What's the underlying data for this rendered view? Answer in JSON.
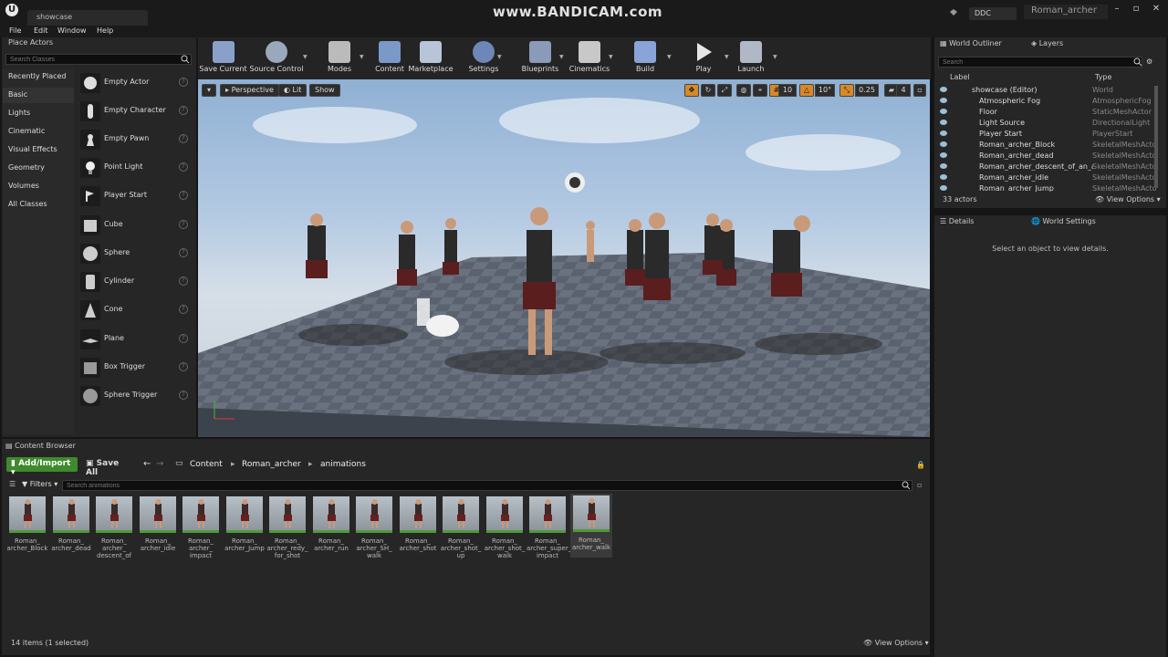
{
  "title_bar": {
    "doc_tab": "showcase",
    "watermark": "www.BANDICAM.com",
    "ddc": "DDC",
    "project": "Roman_archer"
  },
  "menu": [
    "File",
    "Edit",
    "Window",
    "Help"
  ],
  "place_actors": {
    "tab_label": "Place Actors",
    "search_placeholder": "Search Classes",
    "categories": [
      "Recently Placed",
      "Basic",
      "Lights",
      "Cinematic",
      "Visual Effects",
      "Geometry",
      "Volumes",
      "All Classes"
    ],
    "active_category": "Basic",
    "actors": [
      "Empty Actor",
      "Empty Character",
      "Empty Pawn",
      "Point Light",
      "Player Start",
      "Cube",
      "Sphere",
      "Cylinder",
      "Cone",
      "Plane",
      "Box Trigger",
      "Sphere Trigger"
    ]
  },
  "toolbar": {
    "buttons": [
      "Save Current",
      "Source Control",
      "Modes",
      "Content",
      "Marketplace",
      "Settings",
      "Blueprints",
      "Cinematics",
      "Build",
      "Play",
      "Launch"
    ]
  },
  "viewport": {
    "perspective": "Perspective",
    "lit": "Lit",
    "show": "Show",
    "grid_snap": "10",
    "rot_snap": "10°",
    "scale_snap": "0.25",
    "cam_speed": "4"
  },
  "world_outliner": {
    "tab_label": "World Outliner",
    "layers_tab": "Layers",
    "search_placeholder": "Search",
    "col_label": "Label",
    "col_type": "Type",
    "rows": [
      {
        "label": "showcase (Editor)",
        "type": "World"
      },
      {
        "label": "Atmospheric Fog",
        "type": "AtmosphericFog"
      },
      {
        "label": "Floor",
        "type": "StaticMeshActor"
      },
      {
        "label": "Light Source",
        "type": "DirectionalLight"
      },
      {
        "label": "Player Start",
        "type": "PlayerStart"
      },
      {
        "label": "Roman_archer_Block",
        "type": "SkeletalMeshActo"
      },
      {
        "label": "Roman_archer_dead",
        "type": "SkeletalMeshActo"
      },
      {
        "label": "Roman_archer_descent_of_an_arro",
        "type": "SkeletalMeshActo"
      },
      {
        "label": "Roman_archer_idle",
        "type": "SkeletalMeshActo"
      },
      {
        "label": "Roman_archer_Jump",
        "type": "SkeletalMeshActo"
      }
    ],
    "count": "33 actors",
    "view_options": "View Options"
  },
  "details": {
    "tab_label": "Details",
    "world_settings_tab": "World Settings",
    "empty_message": "Select an object to view details."
  },
  "content_browser": {
    "tab_label": "Content Browser",
    "add_import": "Add/Import",
    "save_all": "Save All",
    "breadcrumb": [
      "Content",
      "Roman_archer",
      "animations"
    ],
    "filters": "Filters",
    "search_placeholder": "Search animations",
    "assets": [
      [
        "Roman_",
        "archer_Block"
      ],
      [
        "Roman_",
        "archer_dead"
      ],
      [
        "Roman_",
        "archer_",
        "descent_of"
      ],
      [
        "Roman_",
        "archer_idle"
      ],
      [
        "Roman_",
        "archer_",
        "impact"
      ],
      [
        "Roman_",
        "archer_Jump"
      ],
      [
        "Roman_",
        "archer_redy_",
        "for_shot"
      ],
      [
        "Roman_",
        "archer_run"
      ],
      [
        "Roman_",
        "archer_SH_",
        "walk"
      ],
      [
        "Roman_",
        "archer_shot"
      ],
      [
        "Roman_",
        "archer_shot_",
        "up"
      ],
      [
        "Roman_",
        "archer_shot_",
        "walk"
      ],
      [
        "Roman_",
        "archer_super_",
        "impact"
      ],
      [
        "Roman_",
        "archer_walk"
      ]
    ],
    "selected_index": 13,
    "count": "14 items (1 selected)",
    "view_options": "View Options"
  },
  "colors": {
    "accent_green": "#3e8a2c",
    "snap_orange": "#d6892b",
    "panel": "#262626"
  }
}
